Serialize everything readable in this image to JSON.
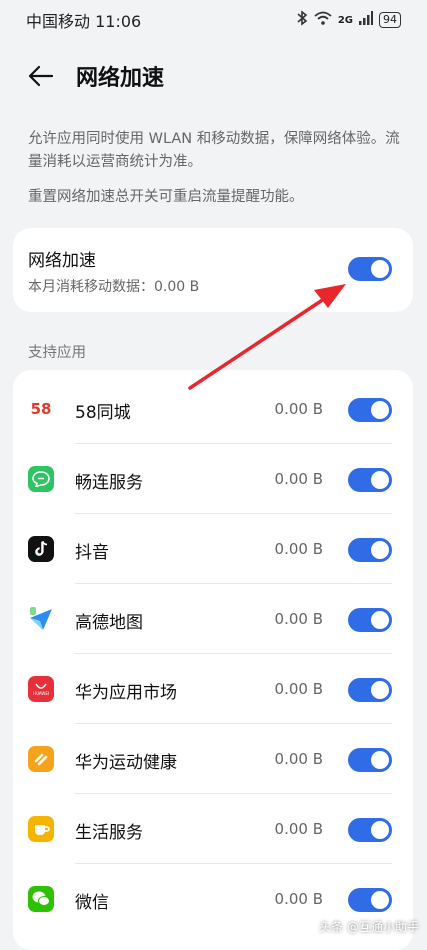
{
  "status_bar": {
    "carrier_time": "中国移动 11:06",
    "network": "2G",
    "battery": "94"
  },
  "header": {
    "title": "网络加速"
  },
  "description": {
    "line1": "允许应用同时使用 WLAN 和移动数据，保障网络体验。流量消耗以运营商统计为准。",
    "line2": "重置网络加速总开关可重启流量提醒功能。"
  },
  "main_toggle": {
    "title": "网络加速",
    "subtitle": "本月消耗移动数据：0.00 B",
    "enabled": true
  },
  "section_label": "支持应用",
  "apps": [
    {
      "name": "58同城",
      "value": "0.00 B",
      "enabled": true,
      "icon": "58-icon"
    },
    {
      "name": "畅连服务",
      "value": "0.00 B",
      "enabled": true,
      "icon": "chat-icon"
    },
    {
      "name": "抖音",
      "value": "0.00 B",
      "enabled": true,
      "icon": "douyin-icon"
    },
    {
      "name": "高德地图",
      "value": "0.00 B",
      "enabled": true,
      "icon": "map-icon"
    },
    {
      "name": "华为应用市场",
      "value": "0.00 B",
      "enabled": true,
      "icon": "appstore-icon"
    },
    {
      "name": "华为运动健康",
      "value": "0.00 B",
      "enabled": true,
      "icon": "health-icon"
    },
    {
      "name": "生活服务",
      "value": "0.00 B",
      "enabled": true,
      "icon": "cup-icon"
    },
    {
      "name": "微信",
      "value": "0.00 B",
      "enabled": true,
      "icon": "wechat-icon"
    }
  ],
  "icon_texts": {
    "huawei": "HUAWEI",
    "fiftyeight": "58"
  },
  "watermark": "头条 @互通小助手",
  "colors": {
    "accent": "#2f6ce5",
    "arrow": "#e8262c",
    "background": "#f1f3f5"
  }
}
